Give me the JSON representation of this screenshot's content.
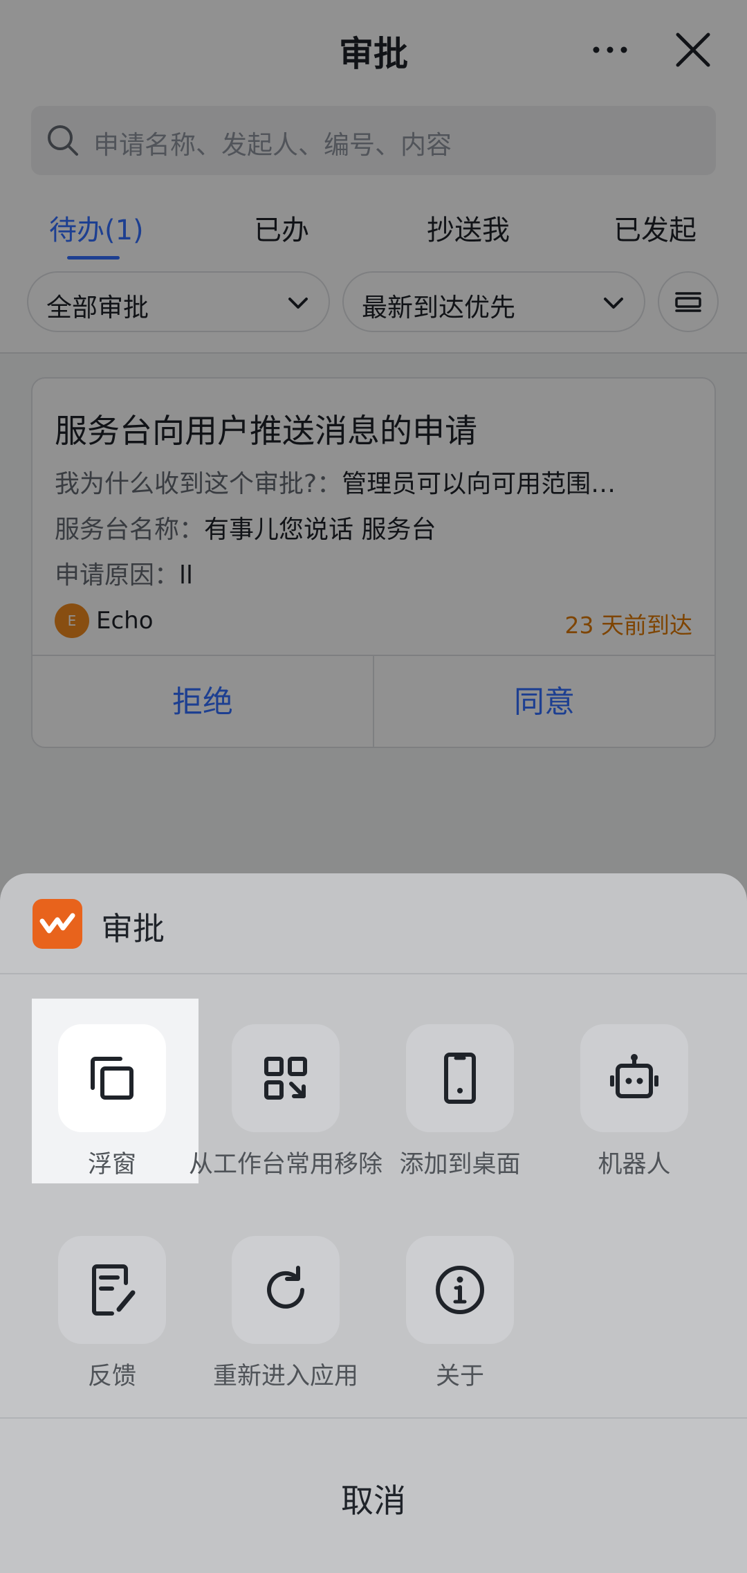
{
  "header": {
    "title": "审批"
  },
  "search": {
    "placeholder": "申请名称、发起人、编号、内容"
  },
  "tabs": [
    {
      "label": "待办(1)",
      "active": true
    },
    {
      "label": "已办"
    },
    {
      "label": "抄送我"
    },
    {
      "label": "已发起"
    }
  ],
  "filters": {
    "category": "全部审批",
    "sort": "最新到达优先"
  },
  "card": {
    "title": "服务台向用户推送消息的申请",
    "rows": [
      {
        "key": "我为什么收到这个审批?：",
        "value": "管理员可以向可用范围…"
      },
      {
        "key": "服务台名称：",
        "value": "有事儿您说话 服务台"
      },
      {
        "key": "申请原因：",
        "value": "ll"
      }
    ],
    "avatar_letter": "E",
    "author": "Echo",
    "arrived": "23 天前到达",
    "reject": "拒绝",
    "agree": "同意"
  },
  "sheet": {
    "app_name": "审批",
    "actions": [
      {
        "label": "浮窗",
        "icon": "float-window-icon"
      },
      {
        "label": "从工作台常用移除",
        "icon": "remove-from-workbench-icon"
      },
      {
        "label": "添加到桌面",
        "icon": "add-to-desktop-icon"
      },
      {
        "label": "机器人",
        "icon": "robot-icon"
      },
      {
        "label": "反馈",
        "icon": "feedback-icon"
      },
      {
        "label": "重新进入应用",
        "icon": "refresh-icon"
      },
      {
        "label": "关于",
        "icon": "info-icon"
      }
    ],
    "cancel": "取消"
  },
  "colors": {
    "accent": "#3370ff",
    "warning": "#de7802",
    "app_logo": "#e8631c"
  }
}
